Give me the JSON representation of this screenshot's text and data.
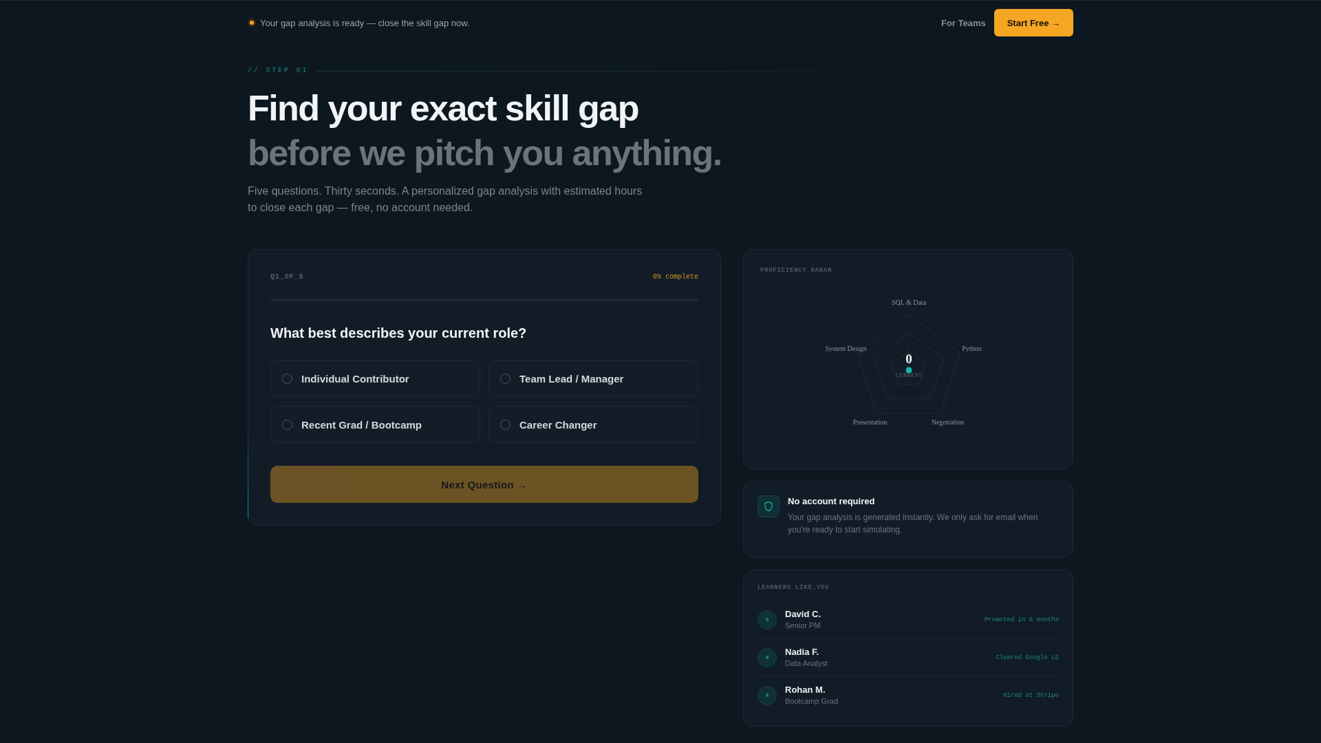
{
  "announcement": {
    "text": "Your gap analysis is ready — close the skill gap now."
  },
  "nav": {
    "links": [
      "For Teams"
    ],
    "cta": "Start Free →"
  },
  "hero": {
    "eyebrow": "// STEP 01",
    "title": "Find your exact skill gap",
    "title_accent": "before we pitch you anything.",
    "subtitle": "Five questions. Thirty seconds. A personalized gap analysis with estimated hours to close each gap — free, no account needed."
  },
  "quiz": {
    "step_label": "Q1_OF_5",
    "progress_text": "0% complete",
    "progress": {
      "level": 0
    },
    "question": "What best describes your current role?",
    "options": [
      {
        "label": "Individual Contributor",
        "selected": false
      },
      {
        "label": "Team Lead / Manager",
        "selected": false
      },
      {
        "label": "Recent Grad / Bootcamp",
        "selected": false
      },
      {
        "label": "Career Changer",
        "selected": false
      }
    ],
    "next_button": {
      "label": "Next Question →",
      "disabled": true
    }
  },
  "radar": {
    "title": "PROFICIENCY_RADAR",
    "axes": [
      "SQL & Data",
      "Python",
      "Negotiation",
      "Presentation",
      "System Design"
    ],
    "score": "0",
    "score_label": "CURRENT"
  },
  "notice": {
    "title": "No account required",
    "text": "Your gap analysis is generated instantly. We only ask for email when you're ready to start simulating."
  },
  "learners": {
    "title": "LEARNERS_LIKE_YOU",
    "items": [
      {
        "initial": "D",
        "name": "David C.",
        "role": "Senior PM",
        "outcome": "Promoted in 6 months"
      },
      {
        "initial": "N",
        "name": "Nadia F.",
        "role": "Data Analyst",
        "outcome": "Cleared Google L5"
      },
      {
        "initial": "R",
        "name": "Rohan M.",
        "role": "Bootcamp Grad",
        "outcome": "Hired at Stripe"
      }
    ]
  }
}
